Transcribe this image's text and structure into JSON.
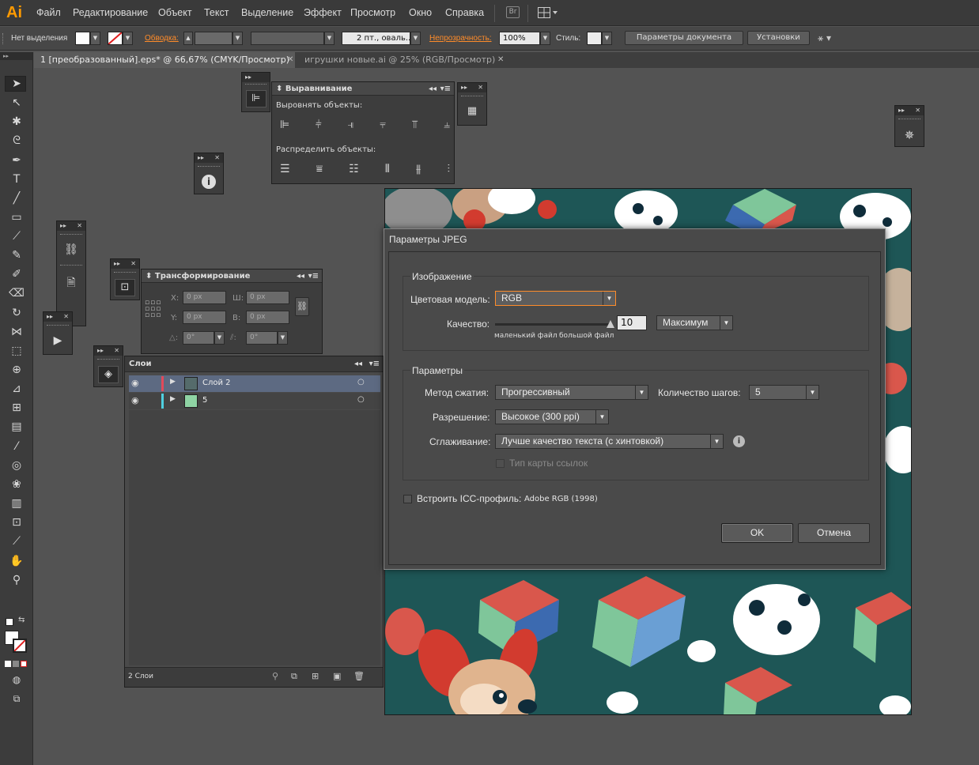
{
  "app": {
    "logo": "Ai",
    "accent": "#ff9a00"
  },
  "menu": [
    "Файл",
    "Редактирование",
    "Объект",
    "Текст",
    "Выделение",
    "Эффект",
    "Просмотр",
    "Окно",
    "Справка"
  ],
  "menu_extra": {
    "bridge": "Br"
  },
  "control_bar": {
    "no_selection": "Нет выделения",
    "stroke_label": "Обводка:",
    "brush_value": "2 пт., оваль...",
    "opacity_label": "Непрозрачность:",
    "opacity_value": "100%",
    "style_label": "Стиль:",
    "doc_settings": "Параметры документа",
    "preferences": "Установки"
  },
  "tabs": [
    {
      "title": "1 [преобразованный].eps* @ 66,67% (CMYK/Просмотр)",
      "active": true
    },
    {
      "title": "игрушки новые.ai @ 25% (RGB/Просмотр)",
      "active": false
    }
  ],
  "align_panel": {
    "title": "Выравнивание",
    "align_label": "Выровнять объекты:",
    "distribute_label": "Распределить объекты:"
  },
  "transform_panel": {
    "title": "Трансформирование",
    "x_label": "X:",
    "x_value": "0 px",
    "y_label": "Y:",
    "y_value": "0 px",
    "w_label": "Ш:",
    "w_value": "0 px",
    "h_label": "В:",
    "h_value": "0 px",
    "rot_value": "0°",
    "shear_value": "0°"
  },
  "layers_panel": {
    "title": "Слои",
    "layers": [
      {
        "name": "Слой 2",
        "color": "#e24a5a",
        "thumb": "#556b6b",
        "selected": true
      },
      {
        "name": "5",
        "color": "#4fd0e0",
        "thumb": "#8fd4a4",
        "selected": false
      }
    ],
    "footer": "2 Слои"
  },
  "dialog": {
    "title": "Параметры JPEG",
    "image_group": "Изображение",
    "color_model_label": "Цветовая модель:",
    "color_model_value": "RGB",
    "quality_label": "Качество:",
    "quality_value": "10",
    "quality_level": 1.0,
    "quality_preset": "Максимум",
    "small_file": "маленький файл",
    "large_file": "большой файл",
    "params_group": "Параметры",
    "compression_label": "Метод сжатия:",
    "compression_value": "Прогрессивный",
    "steps_label": "Количество шагов:",
    "steps_value": "5",
    "resolution_label": "Разрешение:",
    "resolution_value": "Высокое (300 ppi)",
    "antialias_label": "Сглаживание:",
    "antialias_value": "Лучше качество текста (с хинтовкой)",
    "imagemap_label": "Тип карты ссылок",
    "icc_label": "Встроить ICC-профиль:",
    "icc_value": "Adobe RGB (1998)",
    "ok": "OK",
    "cancel": "Отмена"
  }
}
